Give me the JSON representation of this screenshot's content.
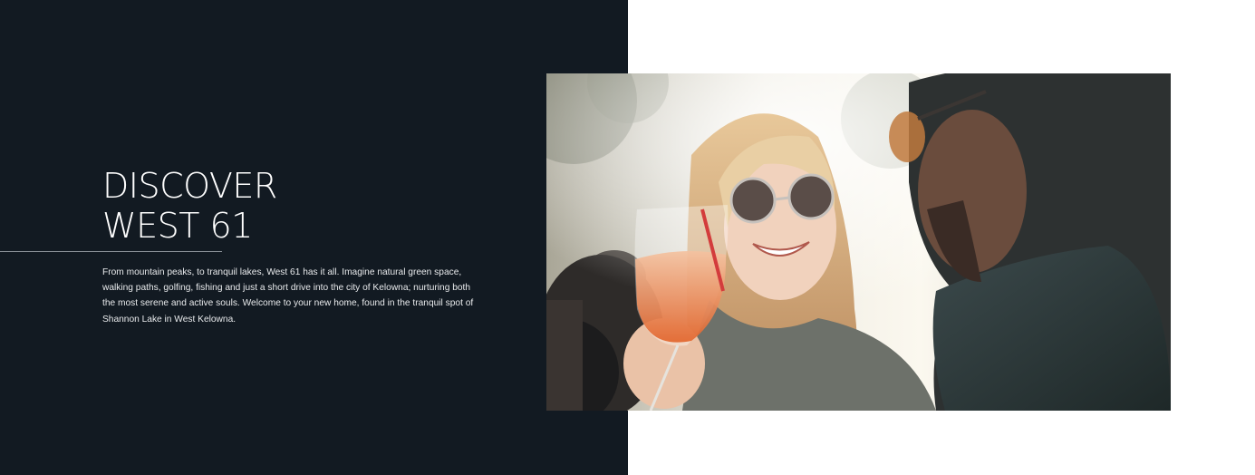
{
  "hero": {
    "heading_line1": "DISCOVER",
    "heading_line2": "WEST 61",
    "body": "From mountain peaks, to tranquil lakes, West 61 has it all. Imagine natural green space, walking paths, golfing, fishing and just a short drive into the city of Kelowna; nurturing both the most serene and active souls. Welcome to your new home, found in the tranquil spot of Shannon Lake in West Kelowna."
  },
  "photo": {
    "subject": "woman-with-sunglasses-toasting-drink-photo"
  },
  "colors": {
    "panel_background": "#121a22",
    "page_background": "#ffffff",
    "heading": "#ffffff",
    "body_text": "#e8eaec",
    "rule": "#8c939a"
  }
}
